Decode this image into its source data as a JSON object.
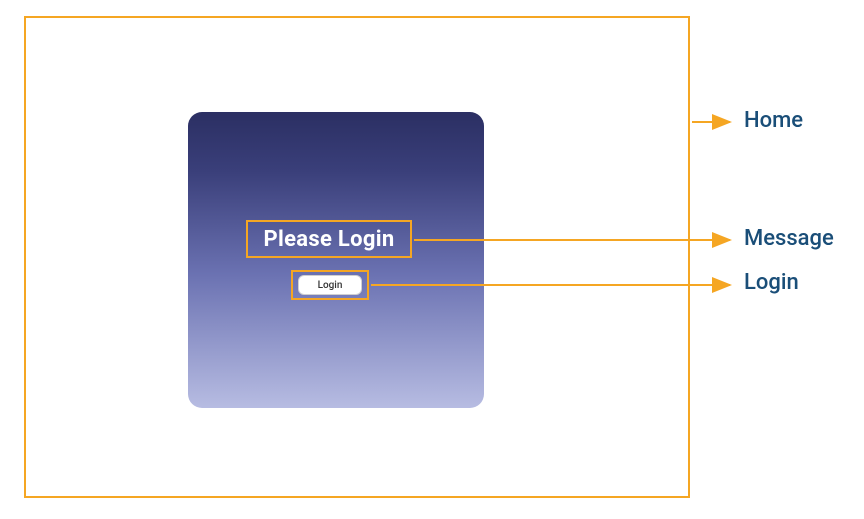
{
  "colors": {
    "accent_orange": "#F5A623",
    "label_blue": "#1a4e78",
    "card_gradient_top": "#2b2f63",
    "card_gradient_bottom": "#b7bce2"
  },
  "labels": {
    "home": "Home",
    "message": "Message",
    "login": "Login"
  },
  "card": {
    "message_text": "Please Login",
    "button_label": "Login"
  }
}
